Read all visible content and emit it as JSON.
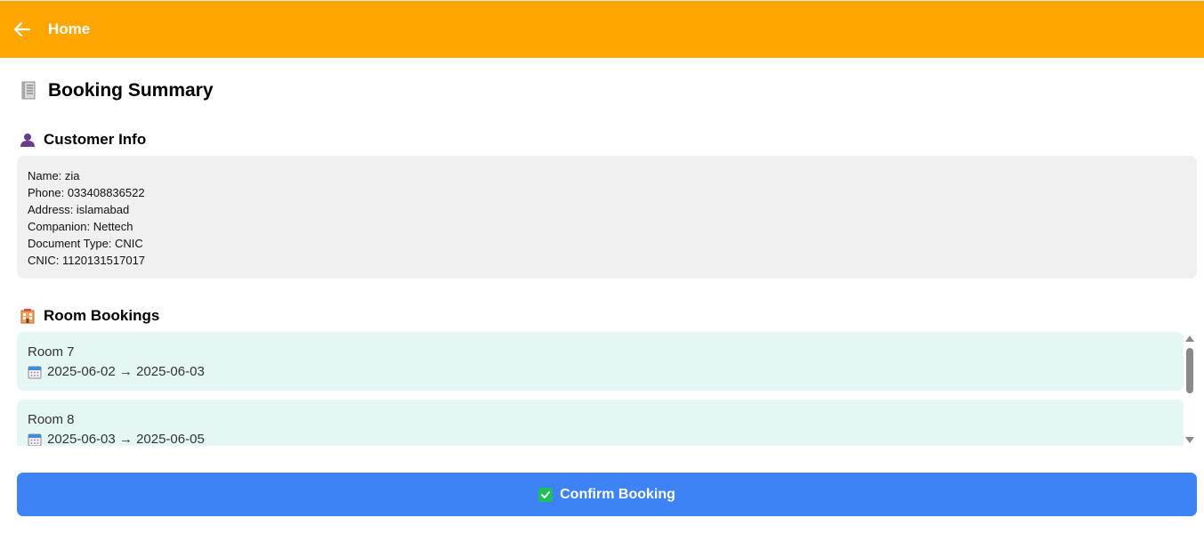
{
  "appbar": {
    "title": "Home",
    "back_icon": "arrow-left-icon",
    "color": "#ffa600"
  },
  "page": {
    "title": "Booking Summary",
    "title_icon": "receipt-icon"
  },
  "customer_section": {
    "title": "Customer Info",
    "icon": "person-icon",
    "lines": [
      "Name: zia",
      "Phone: 033408836522",
      "Address: islamabad",
      "Companion: Nettech",
      "Document Type: CNIC",
      "CNIC: 1120131517017"
    ]
  },
  "rooms_section": {
    "title": "Room Bookings",
    "icon": "hotel-icon",
    "bookings": [
      {
        "room": "Room 7",
        "dates": "2025-06-02 → 2025-06-03",
        "icon": "calendar-icon"
      },
      {
        "room": "Room 8",
        "dates": "2025-06-03 → 2025-06-05",
        "icon": "calendar-icon"
      }
    ]
  },
  "confirm": {
    "label": "Confirm Booking",
    "icon": "check-box-icon",
    "color": "#3d83f5"
  }
}
